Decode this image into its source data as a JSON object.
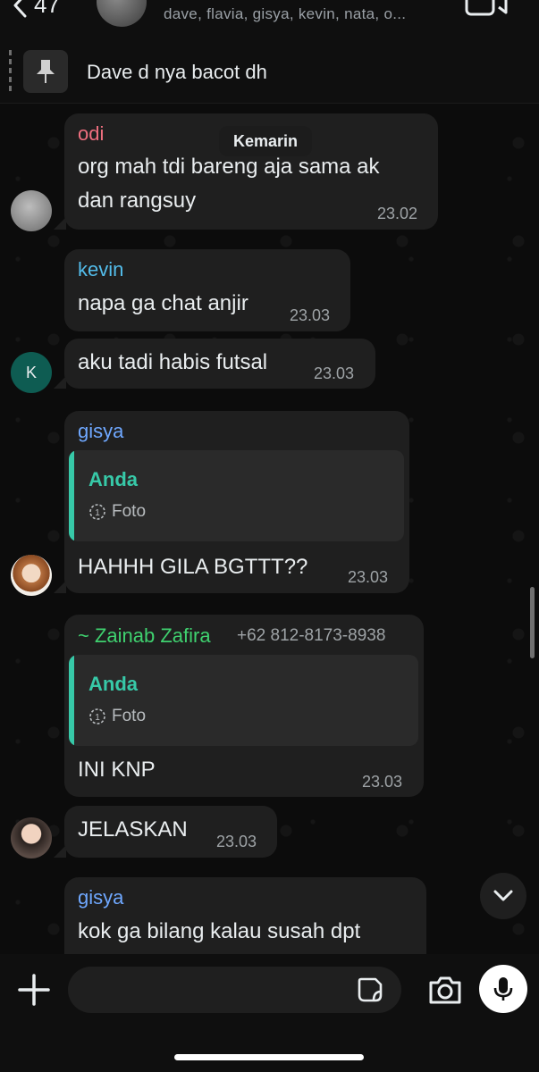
{
  "header": {
    "back_count": "47",
    "members": "dave, flavia, gisya, kevin, nata, o..."
  },
  "pinned": {
    "text": "Dave d nya bacot dh"
  },
  "date_chip": "Kemarin",
  "messages": [
    {
      "sender": "odi",
      "sender_color": "#ef6f7f",
      "lines": [
        "org mah tdi bareng aja sama ak",
        "dan rangsuy"
      ],
      "time": "23.02"
    },
    {
      "sender": "kevin",
      "sender_color": "#53bdeb",
      "text": "napa ga chat anjir",
      "time": "23.03"
    },
    {
      "text": "aku tadi habis futsal",
      "time": "23.03",
      "avatar_letter": "K"
    },
    {
      "sender": "gisya",
      "sender_color": "#6fa8ff",
      "quote_name": "Anda",
      "quote_type": "Foto",
      "text": "HAHHH GILA BGTTT??",
      "time": "23.03"
    },
    {
      "sender": "~ Zainab Zafira",
      "sender_color": "#3fd16f",
      "phone": "+62 812-8173-8938",
      "quote_name": "Anda",
      "quote_type": "Foto",
      "text": "INI KNP",
      "time": "23.03"
    },
    {
      "text": "JELASKAN",
      "time": "23.03"
    },
    {
      "sender": "gisya",
      "sender_color": "#6fa8ff",
      "text": "kok ga bilang kalau susah dpt"
    }
  ],
  "input": {
    "placeholder": ""
  },
  "colors": {
    "quote_accent": "#37c9a8",
    "bubble": "#1f1f1f",
    "background": "#0b0b0b"
  }
}
